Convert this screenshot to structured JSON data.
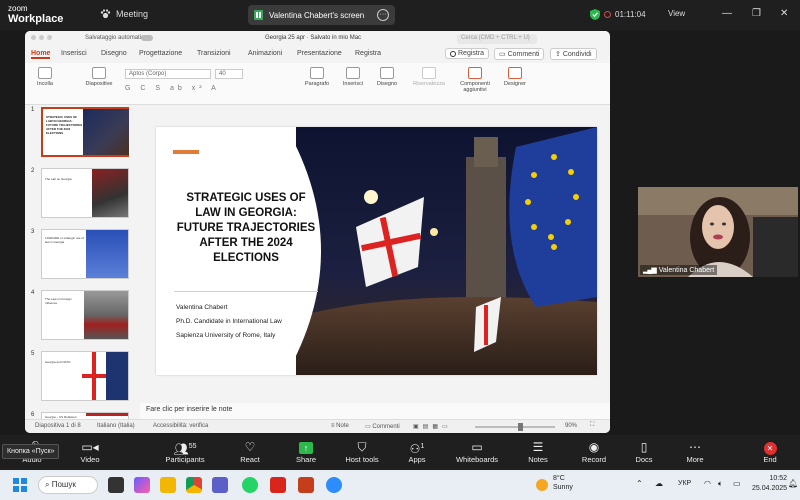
{
  "zoom": {
    "logo_top": "zoom",
    "logo_bottom": "Workplace",
    "meeting_label": "Meeting",
    "screen_share_label": "Valentina Chabert's screen",
    "timer": "01:11:04",
    "view_label": "View",
    "colors": {
      "bar": "#1f1f1f",
      "green": "#2db84d"
    }
  },
  "ppt": {
    "autosave_label": "Salvataggio automatico",
    "file_title": "Georgia 25 apr  ·  Salvato in mio Mac",
    "search_placeholder": "Cerca (CMD + CTRL + U)",
    "tabs": [
      "Home",
      "Inserisci",
      "Disegno",
      "Progettazione",
      "Transizioni",
      "Animazioni",
      "Presentazione",
      "Registra"
    ],
    "right_buttons": {
      "record": "Registra",
      "comments": "Commenti",
      "share": "Condividi"
    },
    "ribbon": {
      "paste": "Incolla",
      "layout": "Diapositive",
      "font_name": "Aptos (Corpo)",
      "font_size": "40",
      "paragraph": "Paragrafo",
      "insert": "Inserisci",
      "draw": "Disegno",
      "sensitivity": "Riservatezza",
      "addins": "Componenti aggiuntivi",
      "designer": "Designer"
    },
    "thumbnails": [
      {
        "num": "1",
        "title": "STRATEGIC USES OF LAW IN GEORGIA: FUTURE TRAJECTORIES AFTER THE 2024 ELECTIONS"
      },
      {
        "num": "2",
        "title": "The Lab on Georgia"
      },
      {
        "num": "3",
        "title": "LAWFARE or strategic use of law in Georgia"
      },
      {
        "num": "4",
        "title": "The Law on Foreign Influence"
      },
      {
        "num": "5",
        "title": "Georgia and NATO"
      },
      {
        "num": "6",
        "title": "Georgia – US Relations: the Megobari Act"
      }
    ],
    "slide": {
      "title": "STRATEGIC USES OF LAW IN GEORGIA: FUTURE TRAJECTORIES AFTER THE 2024 ELECTIONS",
      "author": "Valentina Chabert",
      "role": "Ph.D. Candidate in International Law",
      "affiliation": "Sapienza University of Rome, Italy",
      "accent_color": "#e07b39"
    },
    "notes_placeholder": "Fare clic per inserire le note",
    "status": {
      "slide_info": "Diapositiva 1 di 8",
      "language": "Italiano (Italia)",
      "accessibility": "Accessibilità: verifica",
      "notes_btn": "Note",
      "comments_btn": "Commenti",
      "zoom_level": "90%"
    }
  },
  "participant": {
    "name": "Valentina Chabert"
  },
  "toolbar": {
    "audio": "Audio",
    "video": "Video",
    "participants": "Participants",
    "participants_count": "55",
    "react": "React",
    "share": "Share",
    "host_tools": "Host tools",
    "apps": "Apps",
    "apps_count": "1",
    "whiteboards": "Whiteboards",
    "notes": "Notes",
    "record": "Record",
    "docs": "Docs",
    "more": "More",
    "end": "End"
  },
  "tooltip": "Кнопка «Пуск»",
  "taskbar": {
    "search": "Пошук",
    "weather_temp": "8°C",
    "weather_desc": "Sunny",
    "lang": "УКР",
    "time": "10:52",
    "date": "25.04.2025"
  }
}
